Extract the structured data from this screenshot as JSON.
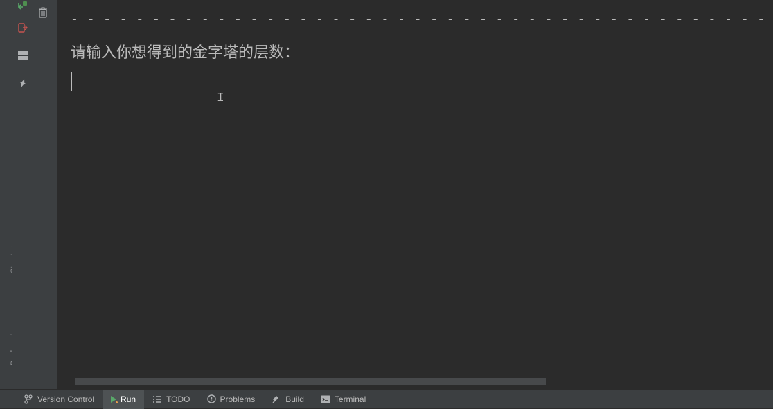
{
  "leftStrip": {
    "labels": [
      "Structure",
      "Bookmarks"
    ]
  },
  "toolSidebar": {
    "icons": [
      "return-icon",
      "layout-icon",
      "pin-icon"
    ]
  },
  "trashTooltip": "Delete",
  "console": {
    "line1": "- - - - - - - - - - - - - - - - - - - - - - - - - - - - - - - - - - - - - - - - - - -",
    "line2": "请输入你想得到的金字塔的层数："
  },
  "bottomBar": {
    "items": [
      {
        "icon": "branch-icon",
        "label": "Version Control",
        "active": false
      },
      {
        "icon": "play-icon",
        "label": "Run",
        "active": true
      },
      {
        "icon": "list-icon",
        "label": "TODO",
        "active": false
      },
      {
        "icon": "warn-icon",
        "label": "Problems",
        "active": false
      },
      {
        "icon": "hammer-icon",
        "label": "Build",
        "active": false
      },
      {
        "icon": "terminal-icon",
        "label": "Terminal",
        "active": false
      }
    ]
  }
}
